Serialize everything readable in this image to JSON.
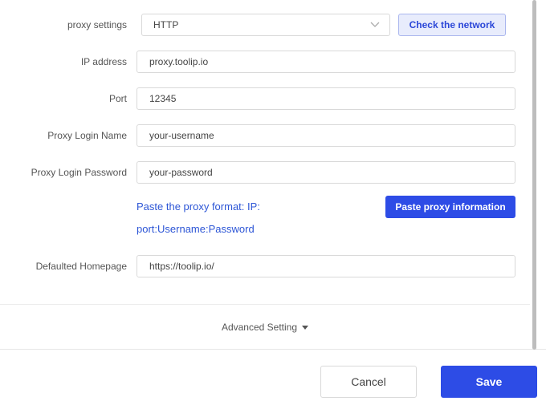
{
  "proxy_settings": {
    "label": "proxy settings",
    "selected": "HTTP",
    "check_button": "Check the network"
  },
  "ip_address": {
    "label": "IP address",
    "value": "proxy.toolip.io"
  },
  "port": {
    "label": "Port",
    "value": "12345"
  },
  "login_name": {
    "label": "Proxy Login Name",
    "value": "your-username"
  },
  "login_password": {
    "label": "Proxy Login Password",
    "value": "your-password"
  },
  "paste": {
    "format_line1": "Paste the proxy format: IP:",
    "format_line2": "port:Username:Password",
    "button": "Paste proxy information"
  },
  "homepage": {
    "label": "Defaulted Homepage",
    "value": "https://toolip.io/"
  },
  "advanced": {
    "label": "Advanced Setting",
    "icon": "caret-down-icon"
  },
  "footer": {
    "cancel": "Cancel",
    "save": "Save"
  },
  "colors": {
    "primary": "#2d4ce6",
    "link": "#2d56d6",
    "check_bg": "#e8ecfc"
  }
}
